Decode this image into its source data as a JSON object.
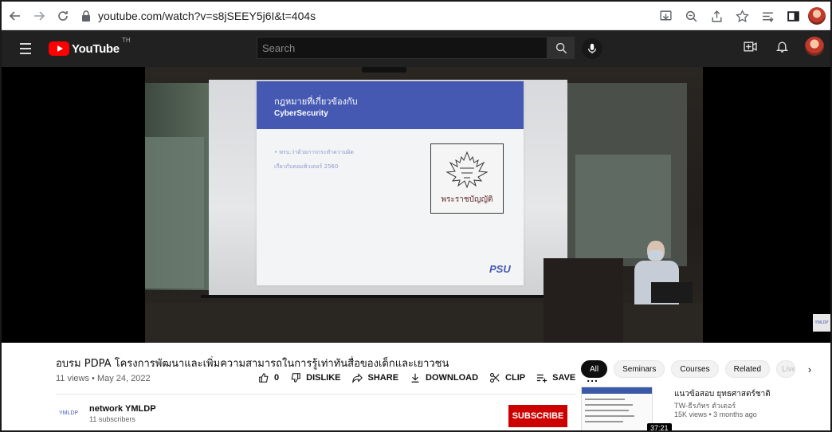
{
  "browser": {
    "url": "youtube.com/watch?v=s8jSEEY5j6I&t=404s",
    "icons": [
      "back-icon",
      "forward-icon",
      "reload-icon",
      "lock-icon",
      "install-icon",
      "zoom-icon",
      "share-icon",
      "bookmark-star-icon",
      "reading-list-icon",
      "side-panel-icon",
      "profile-avatar"
    ]
  },
  "header": {
    "logo_text": "YouTube",
    "region": "TH",
    "search_placeholder": "Search"
  },
  "video": {
    "slide_title_thai": "กฎหมายที่เกี่ยวข้องกับ",
    "slide_title_en": "CyberSecurity",
    "slide_bullet_line1": "• พรบ.ว่าด้วยการกระทำความผิด",
    "slide_bullet_line2": "เกี่ยวกับคอมพิวเตอร์ 2560",
    "emblem_caption": "พระราชบัญญัติ",
    "slide_logo": "PSU"
  },
  "details": {
    "title": "อบรม PDPA โครงการพัฒนาและเพิ่มความสามารถในการรู้เท่าทันสื่อของเด็กและเยาวชน",
    "views": "11 views",
    "separator": "•",
    "date": "May 24, 2022",
    "like_count": "0",
    "dislike_label": "DISLIKE",
    "share_label": "SHARE",
    "download_label": "DOWNLOAD",
    "clip_label": "CLIP",
    "save_label": "SAVE",
    "more_label": "...",
    "channel_logo_text": "YMLDP",
    "channel_name": "network YMLDP",
    "channel_subs": "11 subscribers",
    "subscribe_label": "SUBSCRIBE"
  },
  "chips": [
    "All",
    "Seminars",
    "Courses",
    "Related",
    "Live"
  ],
  "recommended": {
    "title": "แนวข้อสอบ ยุทธศาสตร์ชาติ",
    "channel": "TW-ธีรภัทร ตัวเดอร์",
    "meta": "15K views • 3 months ago",
    "duration": "37:21"
  },
  "colors": {
    "yt_header": "#212121",
    "yt_red": "#ff0000",
    "subscribe_red": "#cc0000",
    "slide_blue": "#4559b3"
  }
}
